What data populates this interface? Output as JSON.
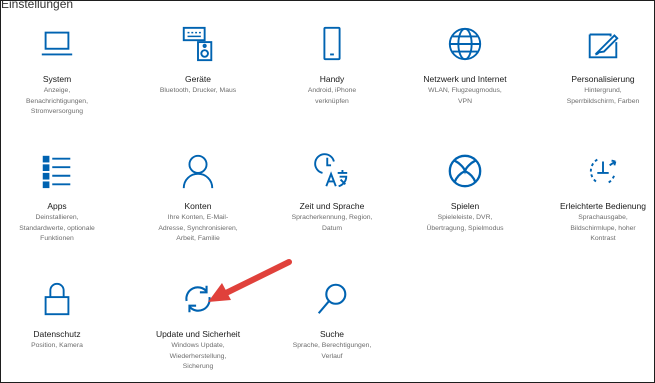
{
  "header": {
    "title": "Einstellungen"
  },
  "colors": {
    "accent": "#0063b1",
    "arrow": "#e0413b"
  },
  "tiles": [
    {
      "icon": "laptop-icon",
      "title": "System",
      "desc": [
        "Anzeige,",
        "Benachrichtigungen,",
        "Stromversorgung"
      ]
    },
    {
      "icon": "keyboard-speaker-icon",
      "title": "Geräte",
      "desc": [
        "Bluetooth, Drucker, Maus"
      ]
    },
    {
      "icon": "phone-icon",
      "title": "Handy",
      "desc": [
        "Android, iPhone",
        "verknüpfen"
      ]
    },
    {
      "icon": "globe-icon",
      "title": "Netzwerk und Internet",
      "desc": [
        "WLAN, Flugzeugmodus,",
        "VPN"
      ]
    },
    {
      "icon": "paint-tablet-icon",
      "title": "Personalisierung",
      "desc": [
        "Hintergrund,",
        "Sperrbildschirm, Farben"
      ]
    },
    {
      "icon": "apps-list-icon",
      "title": "Apps",
      "desc": [
        "Deinstallieren,",
        "Standardwerte, optionale",
        "Funktionen"
      ]
    },
    {
      "icon": "person-icon",
      "title": "Konten",
      "desc": [
        "Ihre Konten, E-Mail-",
        "Adresse, Synchronisieren,",
        "Arbeit, Familie"
      ]
    },
    {
      "icon": "language-time-icon",
      "title": "Zeit und Sprache",
      "desc": [
        "Spracherkennung, Region,",
        "Datum"
      ]
    },
    {
      "icon": "xbox-icon",
      "title": "Spielen",
      "desc": [
        "Spieleleiste, DVR,",
        "Übertragung, Spielmodus"
      ]
    },
    {
      "icon": "ease-of-access-icon",
      "title": "Erleichterte Bedienung",
      "desc": [
        "Sprachausgabe,",
        "Bildschirmlupe, hoher",
        "Kontrast"
      ]
    },
    {
      "icon": "lock-icon",
      "title": "Datenschutz",
      "desc": [
        "Position, Kamera"
      ]
    },
    {
      "icon": "update-sync-icon",
      "title": "Update und Sicherheit",
      "desc": [
        "Windows Update,",
        "Wiederherstellung,",
        "Sicherung"
      ]
    },
    {
      "icon": "search-icon",
      "title": "Suche",
      "desc": [
        "Sprache, Berechtigungen,",
        "Verlauf"
      ]
    }
  ]
}
